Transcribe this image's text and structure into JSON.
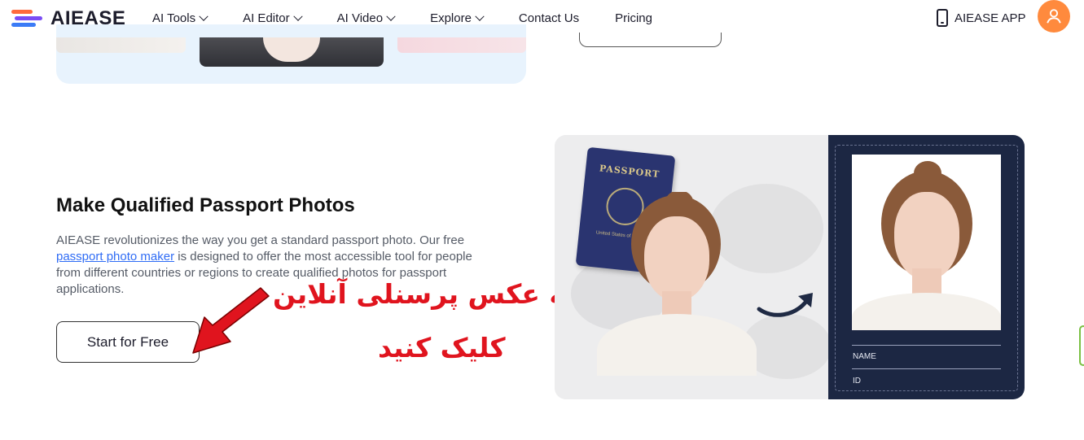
{
  "header": {
    "brand": "AIEASE",
    "nav": [
      {
        "label": "AI Tools",
        "dropdown": true
      },
      {
        "label": "AI Editor",
        "dropdown": true
      },
      {
        "label": "AI Video",
        "dropdown": true
      },
      {
        "label": "Explore",
        "dropdown": true
      },
      {
        "label": "Contact Us",
        "dropdown": false
      },
      {
        "label": "Pricing",
        "dropdown": false
      }
    ],
    "app_label": "AIEASE APP",
    "avatar_icon": "user-icon",
    "brand_color": "#ff8a3d"
  },
  "section": {
    "title": "Make Qualified Passport Photos",
    "desc_before": "AIEASE revolutionizes the way you get a standard passport photo. Our free ",
    "desc_link": "passport photo maker",
    "desc_after": " is designed to offer the most accessible tool for people from different countries or regions to create qualified photos for passport applications.",
    "cta_label": "Start for Free"
  },
  "overlay": {
    "line1": "برای تهیه عکس پرسنلی آنلاین",
    "line2": "کلیک کنید",
    "color": "#e0141e"
  },
  "hero": {
    "passport_label": "PASSPORT",
    "passport_sub": "United States of America",
    "card_fields": [
      "NAME",
      "ID"
    ]
  }
}
